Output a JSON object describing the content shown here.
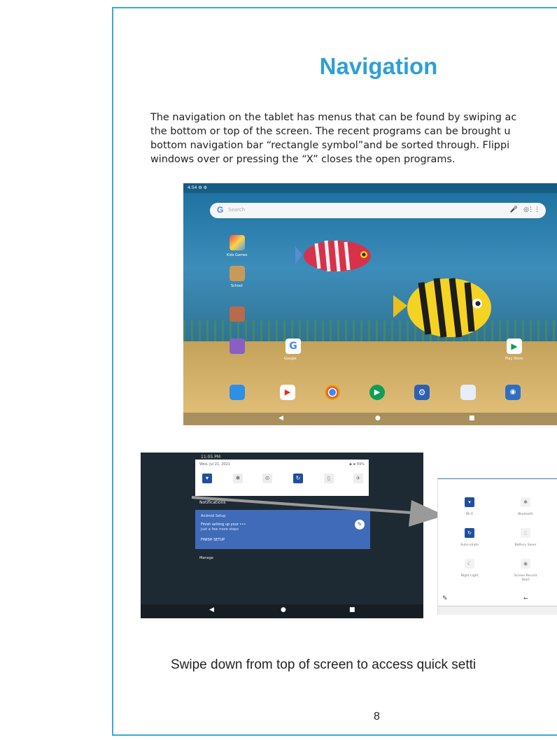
{
  "page": {
    "title": "Navigation",
    "paragraph_lines": [
      "The navigation on the tablet has menus that can be found by swiping ac",
      "the bottom or top of the screen. The recent programs can be brought u",
      "bottom navigation bar “rectangle symbol”and be sorted through. Flippi",
      "windows over or pressing the “X” closes the open programs."
    ],
    "caption": "Swipe down from top of screen to access quick setti",
    "page_number": "8"
  },
  "home_screen": {
    "status_time": "4:54",
    "search_placeholder": "Search",
    "search_logo": "G",
    "icons": {
      "mic": "mic-icon",
      "lens": "lens-icon",
      "grid": "apps-icon"
    },
    "home_apps": [
      "Kids Games",
      "School",
      "Google",
      "Play Store"
    ],
    "dock_apps": [
      "Files",
      "YouTube",
      "Chrome",
      "Play",
      "Settings",
      "Gallery",
      "Camera"
    ],
    "nav_glyphs": {
      "back": "◀",
      "home": "●",
      "recent": "■"
    }
  },
  "quick_panel": {
    "time": "11:05 PM",
    "date": "Wed, Jul 21, 2021",
    "battery": "◆ ▰ 89%",
    "notifications_heading": "Notifications",
    "notification": {
      "app": "Android Setup",
      "title": "Finish setting up your •••",
      "subtitle": "Just a few more steps",
      "action": "FINISH SETUP"
    },
    "manage": "Manage"
  },
  "settings_panel": {
    "tiles": [
      "Wi-Fi",
      "Bluetooth",
      "Auto-rotate",
      "Battery Saver",
      "Night Light",
      "Screen Record"
    ],
    "screen_record_sub": "Start"
  },
  "colors": {
    "frame": "#3aa8db",
    "title": "#2f9fd6",
    "tile_active": "#1f4f9e",
    "notif_card": "#3f6bb9"
  }
}
